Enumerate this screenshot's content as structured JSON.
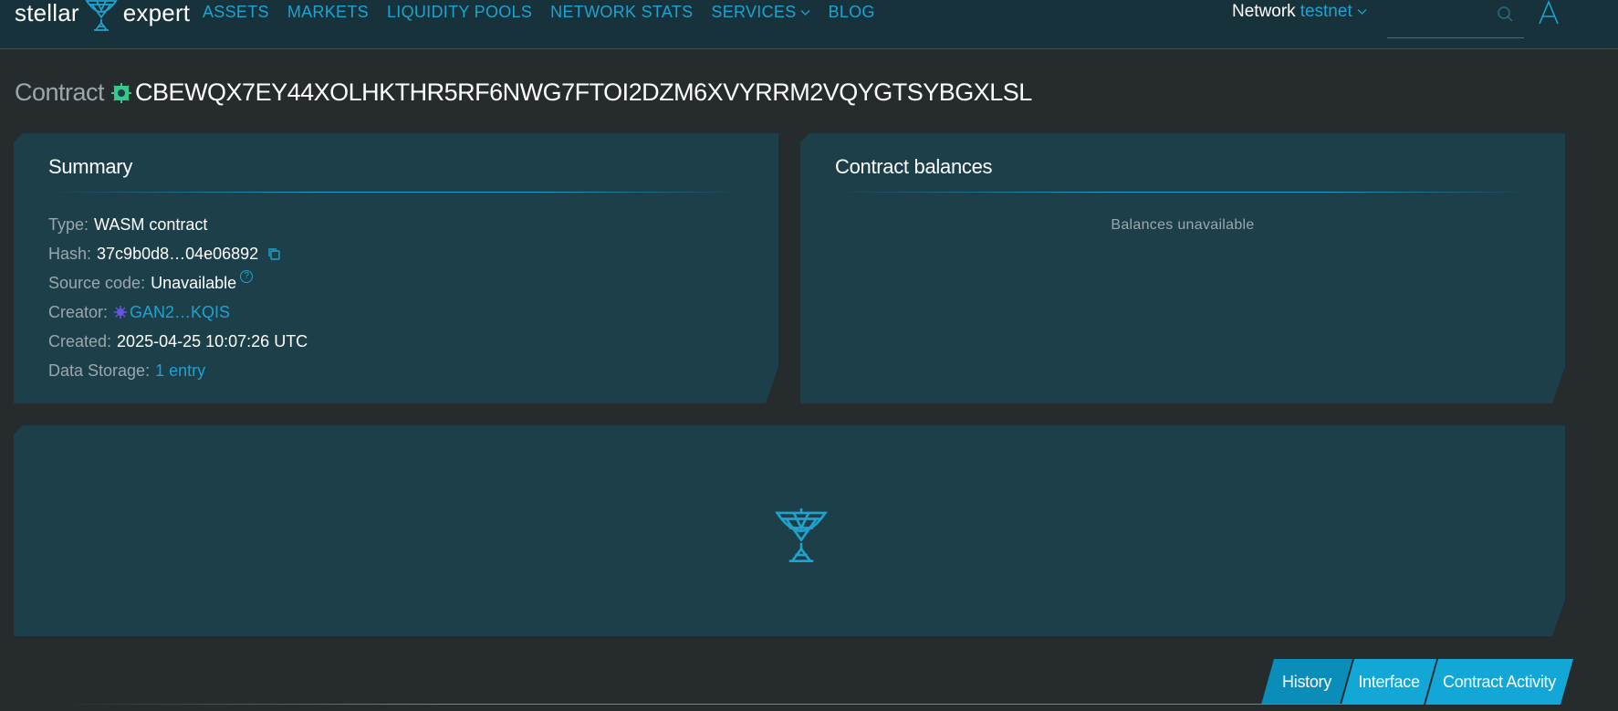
{
  "brand": {
    "left": "stellar",
    "right": "expert",
    "accent_color": "#1ea3d0"
  },
  "nav": {
    "items": [
      {
        "label": "ASSETS"
      },
      {
        "label": "MARKETS"
      },
      {
        "label": "LIQUIDITY POOLS"
      },
      {
        "label": "NETWORK STATS"
      },
      {
        "label": "SERVICES"
      },
      {
        "label": "BLOG"
      }
    ],
    "network_label": "Network",
    "network_value": "testnet",
    "icons": {
      "search": "search-icon",
      "profile": "profile-icon",
      "dropdown": "chevron-down-icon"
    }
  },
  "page": {
    "kind": "Contract",
    "contract_id": "CBEWQX7EY44XOLHKTHR5RF6NWG7FTOI2DZM6XVYRRM2VQYGTSYBGXLSL"
  },
  "summary": {
    "title": "Summary",
    "rows": {
      "type_label": "Type:",
      "type_value": "WASM contract",
      "hash_label": "Hash:",
      "hash_value": "37c9b0d8…04e06892",
      "source_label": "Source code:",
      "source_value": "Unavailable",
      "source_help": "?",
      "creator_label": "Creator:",
      "creator_value": "GAN2…KQIS",
      "created_label": "Created:",
      "created_value": "2025-04-25 10:07:26 UTC",
      "storage_label": "Data Storage:",
      "storage_value": "1 entry"
    }
  },
  "balances": {
    "title": "Contract balances",
    "message": "Balances unavailable"
  },
  "tabs": [
    {
      "label": "History",
      "active": true
    },
    {
      "label": "Interface",
      "active": false
    },
    {
      "label": "Contract Activity",
      "active": false
    }
  ]
}
